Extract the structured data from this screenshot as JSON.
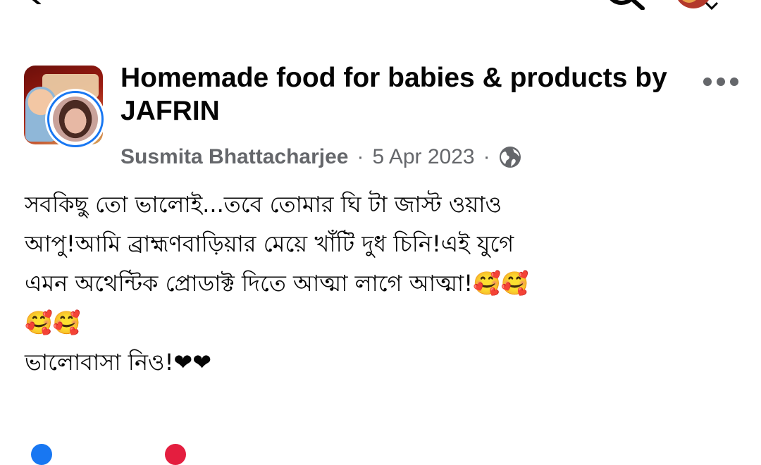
{
  "post": {
    "group_name": "Homemade food for babies & products by JAFRIN",
    "author": "Susmita Bhattacharjee",
    "separator": "·",
    "date": "5 Apr 2023",
    "audience_icon": "globe-icon",
    "body_lines": [
      "সবকিছু তো ভালোই...তবে তোমার ঘি টা জাস্ট ওয়াও",
      "আপু!আমি ব্রাহ্মণবাড়িয়ার মেয়ে খাঁটি দুধ চিনি!এই যুগে",
      "এমন অথেন্টিক প্রোডাক্ট দিতে আত্মা লাগে আত্মা!🥰🥰",
      "🥰🥰",
      "ভালোবাসা নিও!❤❤"
    ]
  },
  "icons": {
    "back": "back-arrow-icon",
    "search": "search-icon",
    "more": "more-options-icon",
    "globe": "globe-icon"
  },
  "colors": {
    "text": "#050505",
    "secondary": "#65676b",
    "accent": "#1877f2",
    "heart": "#e41e3f"
  }
}
